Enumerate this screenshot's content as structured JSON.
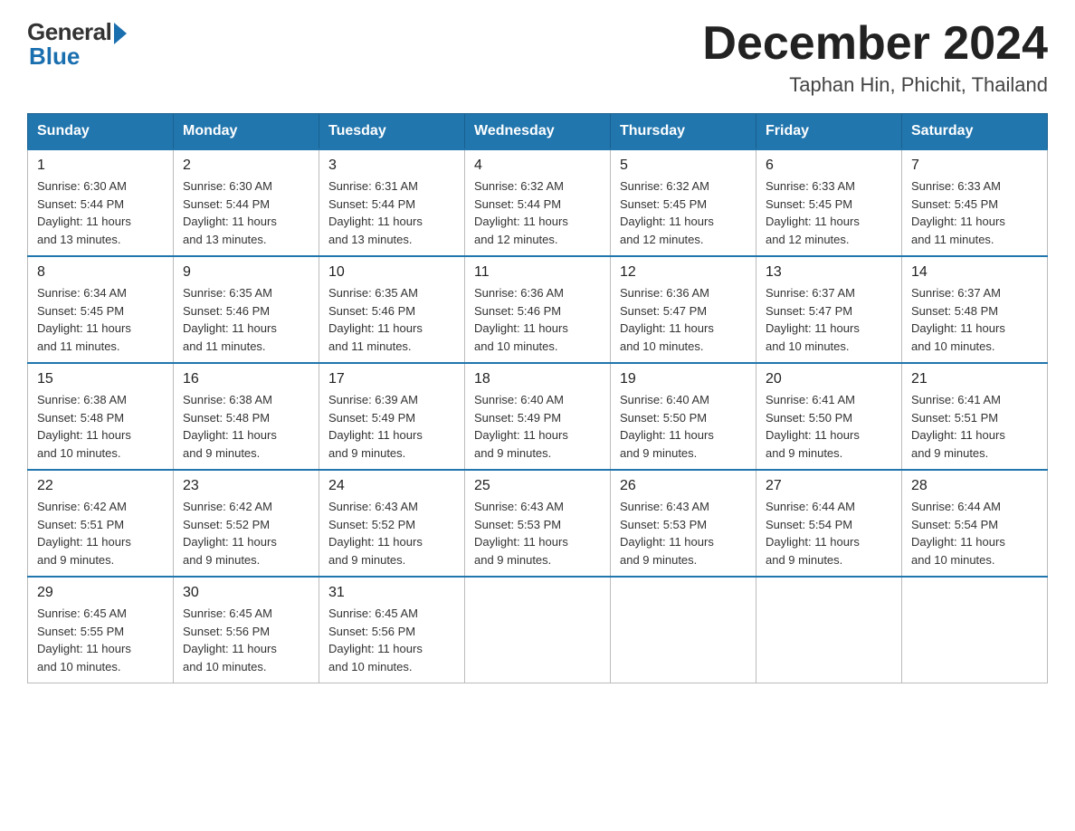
{
  "header": {
    "logo_general": "General",
    "logo_blue": "Blue",
    "month_title": "December 2024",
    "location": "Taphan Hin, Phichit, Thailand"
  },
  "days_of_week": [
    "Sunday",
    "Monday",
    "Tuesday",
    "Wednesday",
    "Thursday",
    "Friday",
    "Saturday"
  ],
  "weeks": [
    [
      {
        "day": "1",
        "sunrise": "6:30 AM",
        "sunset": "5:44 PM",
        "daylight": "11 hours and 13 minutes."
      },
      {
        "day": "2",
        "sunrise": "6:30 AM",
        "sunset": "5:44 PM",
        "daylight": "11 hours and 13 minutes."
      },
      {
        "day": "3",
        "sunrise": "6:31 AM",
        "sunset": "5:44 PM",
        "daylight": "11 hours and 13 minutes."
      },
      {
        "day": "4",
        "sunrise": "6:32 AM",
        "sunset": "5:44 PM",
        "daylight": "11 hours and 12 minutes."
      },
      {
        "day": "5",
        "sunrise": "6:32 AM",
        "sunset": "5:45 PM",
        "daylight": "11 hours and 12 minutes."
      },
      {
        "day": "6",
        "sunrise": "6:33 AM",
        "sunset": "5:45 PM",
        "daylight": "11 hours and 12 minutes."
      },
      {
        "day": "7",
        "sunrise": "6:33 AM",
        "sunset": "5:45 PM",
        "daylight": "11 hours and 11 minutes."
      }
    ],
    [
      {
        "day": "8",
        "sunrise": "6:34 AM",
        "sunset": "5:45 PM",
        "daylight": "11 hours and 11 minutes."
      },
      {
        "day": "9",
        "sunrise": "6:35 AM",
        "sunset": "5:46 PM",
        "daylight": "11 hours and 11 minutes."
      },
      {
        "day": "10",
        "sunrise": "6:35 AM",
        "sunset": "5:46 PM",
        "daylight": "11 hours and 11 minutes."
      },
      {
        "day": "11",
        "sunrise": "6:36 AM",
        "sunset": "5:46 PM",
        "daylight": "11 hours and 10 minutes."
      },
      {
        "day": "12",
        "sunrise": "6:36 AM",
        "sunset": "5:47 PM",
        "daylight": "11 hours and 10 minutes."
      },
      {
        "day": "13",
        "sunrise": "6:37 AM",
        "sunset": "5:47 PM",
        "daylight": "11 hours and 10 minutes."
      },
      {
        "day": "14",
        "sunrise": "6:37 AM",
        "sunset": "5:48 PM",
        "daylight": "11 hours and 10 minutes."
      }
    ],
    [
      {
        "day": "15",
        "sunrise": "6:38 AM",
        "sunset": "5:48 PM",
        "daylight": "11 hours and 10 minutes."
      },
      {
        "day": "16",
        "sunrise": "6:38 AM",
        "sunset": "5:48 PM",
        "daylight": "11 hours and 9 minutes."
      },
      {
        "day": "17",
        "sunrise": "6:39 AM",
        "sunset": "5:49 PM",
        "daylight": "11 hours and 9 minutes."
      },
      {
        "day": "18",
        "sunrise": "6:40 AM",
        "sunset": "5:49 PM",
        "daylight": "11 hours and 9 minutes."
      },
      {
        "day": "19",
        "sunrise": "6:40 AM",
        "sunset": "5:50 PM",
        "daylight": "11 hours and 9 minutes."
      },
      {
        "day": "20",
        "sunrise": "6:41 AM",
        "sunset": "5:50 PM",
        "daylight": "11 hours and 9 minutes."
      },
      {
        "day": "21",
        "sunrise": "6:41 AM",
        "sunset": "5:51 PM",
        "daylight": "11 hours and 9 minutes."
      }
    ],
    [
      {
        "day": "22",
        "sunrise": "6:42 AM",
        "sunset": "5:51 PM",
        "daylight": "11 hours and 9 minutes."
      },
      {
        "day": "23",
        "sunrise": "6:42 AM",
        "sunset": "5:52 PM",
        "daylight": "11 hours and 9 minutes."
      },
      {
        "day": "24",
        "sunrise": "6:43 AM",
        "sunset": "5:52 PM",
        "daylight": "11 hours and 9 minutes."
      },
      {
        "day": "25",
        "sunrise": "6:43 AM",
        "sunset": "5:53 PM",
        "daylight": "11 hours and 9 minutes."
      },
      {
        "day": "26",
        "sunrise": "6:43 AM",
        "sunset": "5:53 PM",
        "daylight": "11 hours and 9 minutes."
      },
      {
        "day": "27",
        "sunrise": "6:44 AM",
        "sunset": "5:54 PM",
        "daylight": "11 hours and 9 minutes."
      },
      {
        "day": "28",
        "sunrise": "6:44 AM",
        "sunset": "5:54 PM",
        "daylight": "11 hours and 10 minutes."
      }
    ],
    [
      {
        "day": "29",
        "sunrise": "6:45 AM",
        "sunset": "5:55 PM",
        "daylight": "11 hours and 10 minutes."
      },
      {
        "day": "30",
        "sunrise": "6:45 AM",
        "sunset": "5:56 PM",
        "daylight": "11 hours and 10 minutes."
      },
      {
        "day": "31",
        "sunrise": "6:45 AM",
        "sunset": "5:56 PM",
        "daylight": "11 hours and 10 minutes."
      },
      null,
      null,
      null,
      null
    ]
  ],
  "labels": {
    "sunrise": "Sunrise:",
    "sunset": "Sunset:",
    "daylight": "Daylight:"
  }
}
